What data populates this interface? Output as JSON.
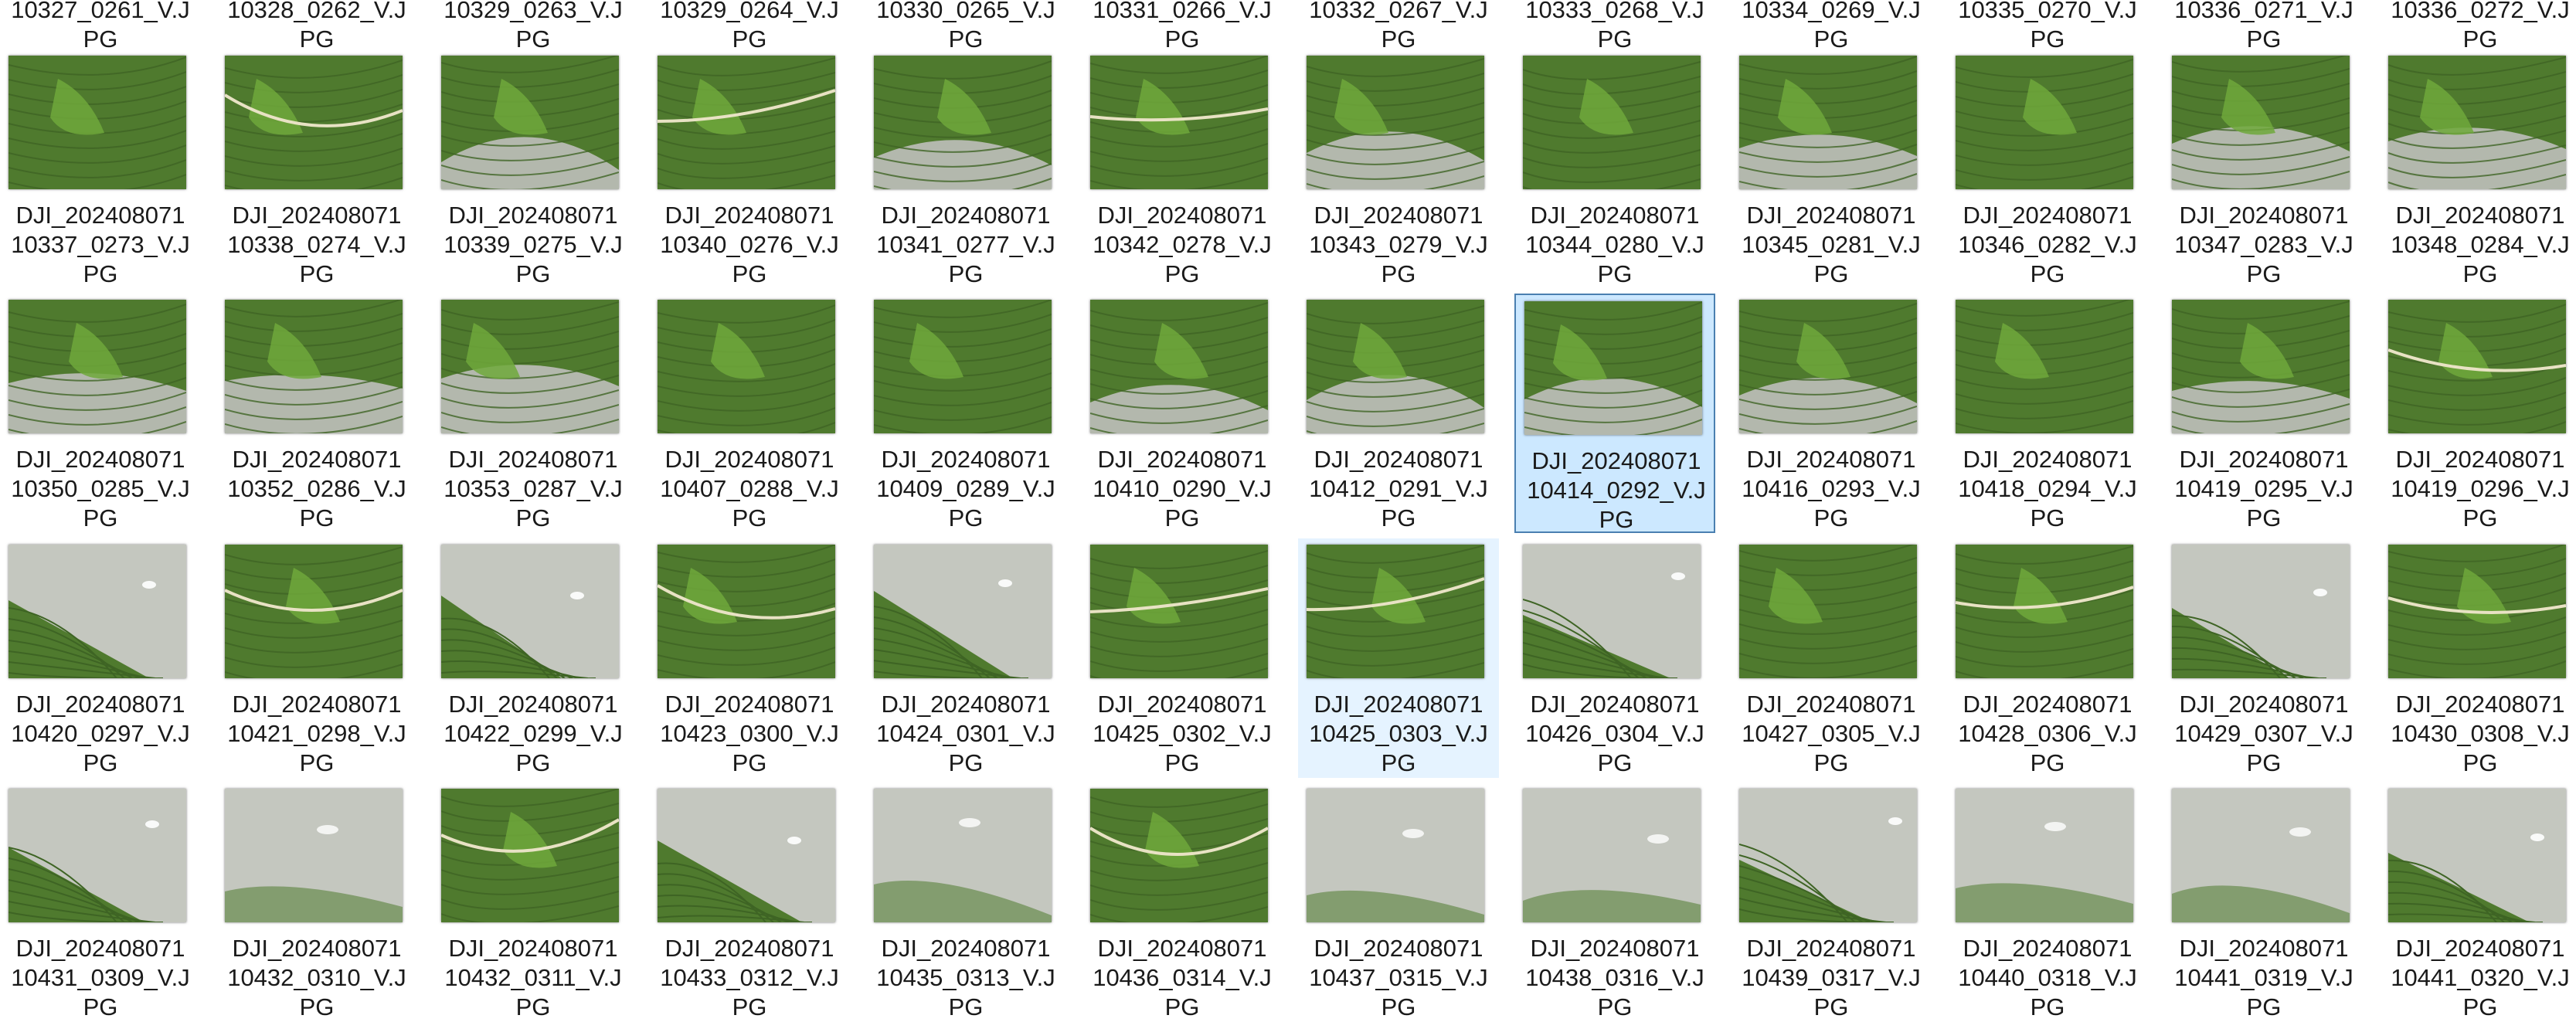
{
  "colors": {
    "selection_fill": "#cce8ff",
    "selection_border": "#4a7fb0",
    "hover_fill": "#e5f3ff",
    "field_green": "#4f7a2e",
    "water_grey": "#b9bdb4"
  },
  "selected_file": "DJI_20240807110414_0292_V.JPG",
  "hovered_file": "DJI_20240807110425_0303_V.JPG",
  "rows": [
    {
      "files": [
        {
          "line1": "",
          "line2": "10327_0261_V.J",
          "line3": "PG",
          "variant": "field"
        },
        {
          "line1": "",
          "line2": "10328_0262_V.J",
          "line3": "PG",
          "variant": "field"
        },
        {
          "line1": "",
          "line2": "10329_0263_V.J",
          "line3": "PG",
          "variant": "field"
        },
        {
          "line1": "",
          "line2": "10329_0264_V.J",
          "line3": "PG",
          "variant": "field"
        },
        {
          "line1": "",
          "line2": "10330_0265_V.J",
          "line3": "PG",
          "variant": "field"
        },
        {
          "line1": "",
          "line2": "10331_0266_V.J",
          "line3": "PG",
          "variant": "field"
        },
        {
          "line1": "",
          "line2": "10332_0267_V.J",
          "line3": "PG",
          "variant": "field"
        },
        {
          "line1": "",
          "line2": "10333_0268_V.J",
          "line3": "PG",
          "variant": "field"
        },
        {
          "line1": "",
          "line2": "10334_0269_V.J",
          "line3": "PG",
          "variant": "field"
        },
        {
          "line1": "",
          "line2": "10335_0270_V.J",
          "line3": "PG",
          "variant": "field"
        },
        {
          "line1": "",
          "line2": "10336_0271_V.J",
          "line3": "PG",
          "variant": "field"
        },
        {
          "line1": "",
          "line2": "10336_0272_V.J",
          "line3": "PG",
          "variant": "field"
        }
      ]
    },
    {
      "files": [
        {
          "line1": "DJI_202408071",
          "line2": "10337_0273_V.J",
          "line3": "PG",
          "variant": "field"
        },
        {
          "line1": "DJI_202408071",
          "line2": "10338_0274_V.J",
          "line3": "PG",
          "variant": "road"
        },
        {
          "line1": "DJI_202408071",
          "line2": "10339_0275_V.J",
          "line3": "PG",
          "variant": "river"
        },
        {
          "line1": "DJI_202408071",
          "line2": "10340_0276_V.J",
          "line3": "PG",
          "variant": "road"
        },
        {
          "line1": "DJI_202408071",
          "line2": "10341_0277_V.J",
          "line3": "PG",
          "variant": "river"
        },
        {
          "line1": "DJI_202408071",
          "line2": "10342_0278_V.J",
          "line3": "PG",
          "variant": "road"
        },
        {
          "line1": "DJI_202408071",
          "line2": "10343_0279_V.J",
          "line3": "PG",
          "variant": "river"
        },
        {
          "line1": "DJI_202408071",
          "line2": "10344_0280_V.J",
          "line3": "PG",
          "variant": "field"
        },
        {
          "line1": "DJI_202408071",
          "line2": "10345_0281_V.J",
          "line3": "PG",
          "variant": "river"
        },
        {
          "line1": "DJI_202408071",
          "line2": "10346_0282_V.J",
          "line3": "PG",
          "variant": "field"
        },
        {
          "line1": "DJI_202408071",
          "line2": "10347_0283_V.J",
          "line3": "PG",
          "variant": "river"
        },
        {
          "line1": "DJI_202408071",
          "line2": "10348_0284_V.J",
          "line3": "PG",
          "variant": "river"
        }
      ]
    },
    {
      "files": [
        {
          "line1": "DJI_202408071",
          "line2": "10350_0285_V.J",
          "line3": "PG",
          "variant": "river"
        },
        {
          "line1": "DJI_202408071",
          "line2": "10352_0286_V.J",
          "line3": "PG",
          "variant": "river"
        },
        {
          "line1": "DJI_202408071",
          "line2": "10353_0287_V.J",
          "line3": "PG",
          "variant": "river"
        },
        {
          "line1": "DJI_202408071",
          "line2": "10407_0288_V.J",
          "line3": "PG",
          "variant": "field"
        },
        {
          "line1": "DJI_202408071",
          "line2": "10409_0289_V.J",
          "line3": "PG",
          "variant": "field"
        },
        {
          "line1": "DJI_202408071",
          "line2": "10410_0290_V.J",
          "line3": "PG",
          "variant": "river"
        },
        {
          "line1": "DJI_202408071",
          "line2": "10412_0291_V.J",
          "line3": "PG",
          "variant": "river"
        },
        {
          "line1": "DJI_202408071",
          "line2": "10414_0292_V.J",
          "line3": "PG",
          "variant": "river"
        },
        {
          "line1": "DJI_202408071",
          "line2": "10416_0293_V.J",
          "line3": "PG",
          "variant": "river"
        },
        {
          "line1": "DJI_202408071",
          "line2": "10418_0294_V.J",
          "line3": "PG",
          "variant": "field"
        },
        {
          "line1": "DJI_202408071",
          "line2": "10419_0295_V.J",
          "line3": "PG",
          "variant": "river"
        },
        {
          "line1": "DJI_202408071",
          "line2": "10419_0296_V.J",
          "line3": "PG",
          "variant": "road"
        }
      ]
    },
    {
      "files": [
        {
          "line1": "DJI_202408071",
          "line2": "10420_0297_V.J",
          "line3": "PG",
          "variant": "sky"
        },
        {
          "line1": "DJI_202408071",
          "line2": "10421_0298_V.J",
          "line3": "PG",
          "variant": "road"
        },
        {
          "line1": "DJI_202408071",
          "line2": "10422_0299_V.J",
          "line3": "PG",
          "variant": "sky"
        },
        {
          "line1": "DJI_202408071",
          "line2": "10423_0300_V.J",
          "line3": "PG",
          "variant": "road"
        },
        {
          "line1": "DJI_202408071",
          "line2": "10424_0301_V.J",
          "line3": "PG",
          "variant": "sky"
        },
        {
          "line1": "DJI_202408071",
          "line2": "10425_0302_V.J",
          "line3": "PG",
          "variant": "road"
        },
        {
          "line1": "DJI_202408071",
          "line2": "10425_0303_V.J",
          "line3": "PG",
          "variant": "road"
        },
        {
          "line1": "DJI_202408071",
          "line2": "10426_0304_V.J",
          "line3": "PG",
          "variant": "sky"
        },
        {
          "line1": "DJI_202408071",
          "line2": "10427_0305_V.J",
          "line3": "PG",
          "variant": "field"
        },
        {
          "line1": "DJI_202408071",
          "line2": "10428_0306_V.J",
          "line3": "PG",
          "variant": "road"
        },
        {
          "line1": "DJI_202408071",
          "line2": "10429_0307_V.J",
          "line3": "PG",
          "variant": "sky"
        },
        {
          "line1": "DJI_202408071",
          "line2": "10430_0308_V.J",
          "line3": "PG",
          "variant": "road"
        }
      ]
    },
    {
      "files": [
        {
          "line1": "DJI_202408071",
          "line2": "10431_0309_V.J",
          "line3": "PG",
          "variant": "sky"
        },
        {
          "line1": "DJI_202408071",
          "line2": "10432_0310_V.J",
          "line3": "PG",
          "variant": "grey"
        },
        {
          "line1": "DJI_202408071",
          "line2": "10432_0311_V.J",
          "line3": "PG",
          "variant": "road"
        },
        {
          "line1": "DJI_202408071",
          "line2": "10433_0312_V.J",
          "line3": "PG",
          "variant": "sky"
        },
        {
          "line1": "DJI_202408071",
          "line2": "10435_0313_V.J",
          "line3": "PG",
          "variant": "grey"
        },
        {
          "line1": "DJI_202408071",
          "line2": "10436_0314_V.J",
          "line3": "PG",
          "variant": "road"
        },
        {
          "line1": "DJI_202408071",
          "line2": "10437_0315_V.J",
          "line3": "PG",
          "variant": "grey"
        },
        {
          "line1": "DJI_202408071",
          "line2": "10438_0316_V.J",
          "line3": "PG",
          "variant": "grey"
        },
        {
          "line1": "DJI_202408071",
          "line2": "10439_0317_V.J",
          "line3": "PG",
          "variant": "sky"
        },
        {
          "line1": "DJI_202408071",
          "line2": "10440_0318_V.J",
          "line3": "PG",
          "variant": "grey"
        },
        {
          "line1": "DJI_202408071",
          "line2": "10441_0319_V.J",
          "line3": "PG",
          "variant": "grey"
        },
        {
          "line1": "DJI_202408071",
          "line2": "10441_0320_V.J",
          "line3": "PG",
          "variant": "sky"
        }
      ]
    }
  ]
}
